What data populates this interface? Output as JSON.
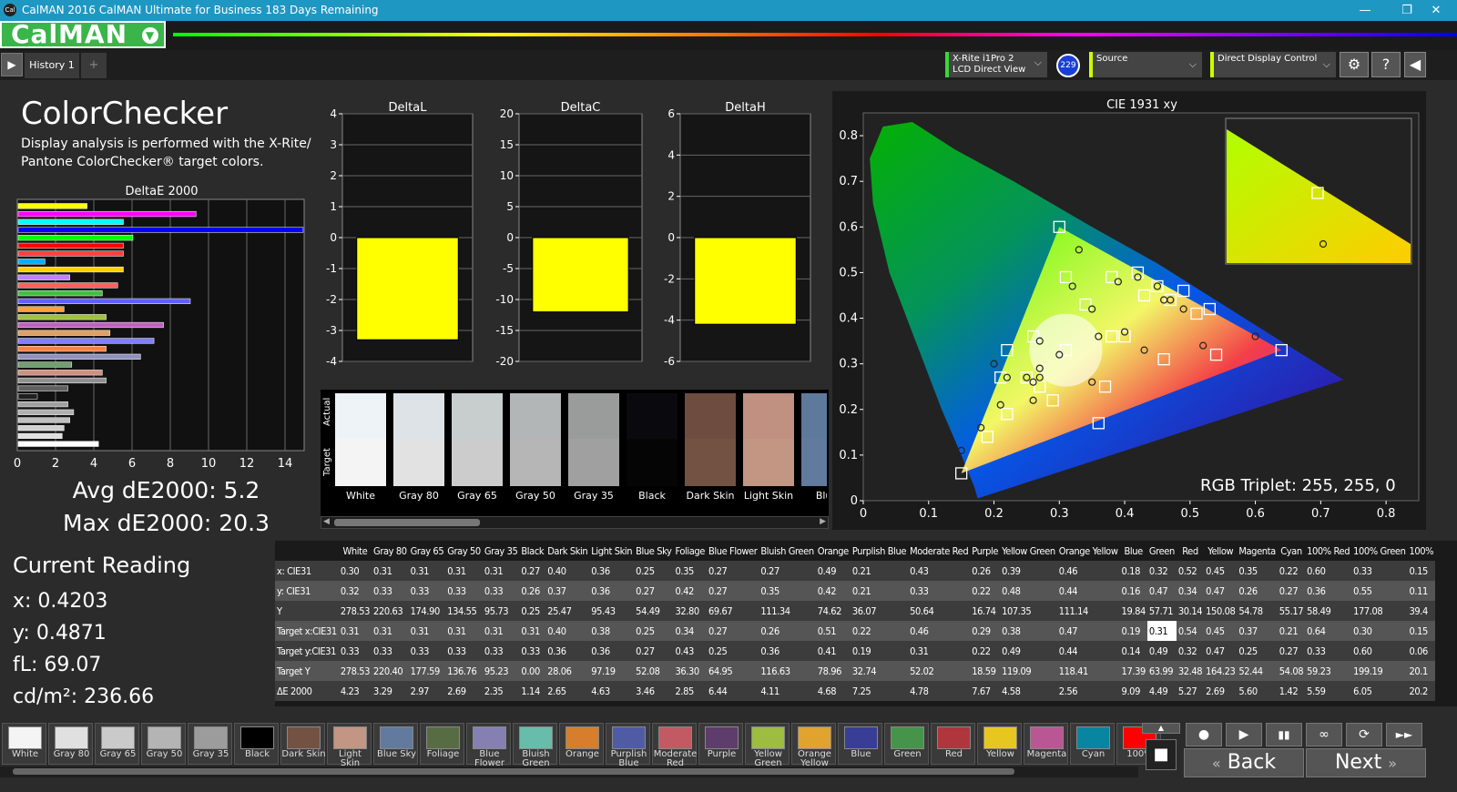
{
  "titlebar": {
    "title": "CalMAN 2016 CalMAN Ultimate for Business 183 Days Remaining",
    "icon": "Cal"
  },
  "logo": {
    "text": "CalMAN"
  },
  "tabs": {
    "history": "History 1",
    "add": "+"
  },
  "devices": {
    "meter_line1": "X-Rite i1Pro 2",
    "meter_line2": "LCD Direct View",
    "badge": "229",
    "source": "Source",
    "display": "Direct Display Control"
  },
  "left": {
    "title": "ColorChecker",
    "desc1": "Display analysis is performed with the X-Rite/",
    "desc2": "Pantone ColorChecker® target colors.",
    "de_title": "DeltaE 2000",
    "avg": "Avg dE2000: 5.2",
    "max": "Max dE2000: 20.3",
    "reading_title": "Current Reading",
    "x": "x: 0.4203",
    "y": "y: 0.4871",
    "fl": "fL: 69.07",
    "cdm": "cd/m²: 236.66"
  },
  "de_bars": {
    "values": [
      3.6,
      9.3,
      5.5,
      14.9,
      6.0,
      5.5,
      5.5,
      1.4,
      5.5,
      2.7,
      5.2,
      4.4,
      9.0,
      2.4,
      4.6,
      7.6,
      4.8,
      7.1,
      4.6,
      6.4,
      2.8,
      4.4,
      4.6,
      2.6,
      1.0,
      2.6,
      2.9,
      2.7,
      2.4,
      2.3,
      4.2
    ],
    "colors": [
      "#ffff00",
      "#ff00ff",
      "#00ffff",
      "#0000ff",
      "#00ff00",
      "#ff0000",
      "#ff4040",
      "#00b0ff",
      "#ffd000",
      "#c080ff",
      "#ff6060",
      "#40c040",
      "#6060ff",
      "#ffa040",
      "#a0c040",
      "#c060c0",
      "#e0a060",
      "#8080ff",
      "#ff8040",
      "#9090c0",
      "#70a070",
      "#d09080",
      "#909090",
      "#606060",
      "#202020",
      "#a0a0a0",
      "#b0b0b0",
      "#c0c0c0",
      "#d0d0d0",
      "#e0e0e0",
      "#ffffff"
    ],
    "ticks": [
      "0",
      "2",
      "4",
      "6",
      "8",
      "10",
      "12",
      "14"
    ]
  },
  "delta_charts": [
    {
      "title": "DeltaL",
      "ticks": [
        "4",
        "3",
        "2",
        "1",
        "0",
        "-1",
        "-2",
        "-3",
        "-4"
      ],
      "min": -4,
      "max": 4,
      "value": -3.3
    },
    {
      "title": "DeltaC",
      "ticks": [
        "20",
        "15",
        "10",
        "5",
        "0",
        "-5",
        "-10",
        "-15",
        "-20"
      ],
      "min": -20,
      "max": 20,
      "value": -12.0
    },
    {
      "title": "DeltaH",
      "ticks": [
        "6",
        "4",
        "2",
        "0",
        "-2",
        "-4",
        "-6"
      ],
      "min": -6,
      "max": 6,
      "value": -4.2
    }
  ],
  "patches": {
    "actual_label": "Actual",
    "target_label": "Target",
    "items": [
      {
        "name": "White",
        "actual": "#eef3f8",
        "target": "#f4f4f4"
      },
      {
        "name": "Gray 80",
        "actual": "#dde3e6",
        "target": "#e2e2e2"
      },
      {
        "name": "Gray 65",
        "actual": "#c8cdcd",
        "target": "#cccccc"
      },
      {
        "name": "Gray 50",
        "actual": "#b3b6b6",
        "target": "#b6b6b6"
      },
      {
        "name": "Gray 35",
        "actual": "#9a9c9c",
        "target": "#a0a0a0"
      },
      {
        "name": "Black",
        "actual": "#0a0a0e",
        "target": "#050505"
      },
      {
        "name": "Dark Skin",
        "actual": "#6e4c40",
        "target": "#735244"
      },
      {
        "name": "Light Skin",
        "actual": "#c09080",
        "target": "#c29682"
      },
      {
        "name": "Blue",
        "actual": "#5d7a9c",
        "target": "#627a9d"
      }
    ]
  },
  "cie": {
    "title": "CIE 1931 xy",
    "triplet": "RGB Triplet: 255, 255, 0",
    "xticks": [
      "0",
      "0.1",
      "0.2",
      "0.3",
      "0.4",
      "0.5",
      "0.6",
      "0.7",
      "0.8"
    ],
    "yticks": [
      "0.8",
      "0.7",
      "0.6",
      "0.5",
      "0.4",
      "0.3",
      "0.2",
      "0.1",
      "0"
    ]
  },
  "table": {
    "headers": [
      "",
      "White",
      "Gray 80",
      "Gray 65",
      "Gray 50",
      "Gray 35",
      "Black",
      "Dark Skin",
      "Light Skin",
      "Blue Sky",
      "Foliage",
      "Blue Flower",
      "Bluish Green",
      "Orange",
      "Purplish Blue",
      "Moderate Red",
      "Purple",
      "Yellow Green",
      "Orange Yellow",
      "Blue",
      "Green",
      "Red",
      "Yellow",
      "Magenta",
      "Cyan",
      "100% Red",
      "100% Green",
      "100%"
    ],
    "rows": [
      [
        "x: CIE31",
        "0.30",
        "0.31",
        "0.31",
        "0.31",
        "0.31",
        "0.27",
        "0.40",
        "0.36",
        "0.25",
        "0.35",
        "0.27",
        "0.27",
        "0.49",
        "0.21",
        "0.43",
        "0.26",
        "0.39",
        "0.46",
        "0.18",
        "0.32",
        "0.52",
        "0.45",
        "0.35",
        "0.22",
        "0.60",
        "0.33",
        "0.15"
      ],
      [
        "y: CIE31",
        "0.32",
        "0.33",
        "0.33",
        "0.33",
        "0.33",
        "0.26",
        "0.37",
        "0.36",
        "0.27",
        "0.42",
        "0.27",
        "0.35",
        "0.42",
        "0.21",
        "0.33",
        "0.22",
        "0.48",
        "0.44",
        "0.16",
        "0.47",
        "0.34",
        "0.47",
        "0.26",
        "0.27",
        "0.36",
        "0.55",
        "0.11"
      ],
      [
        "Y",
        "278.53",
        "220.63",
        "174.90",
        "134.55",
        "95.73",
        "0.25",
        "25.47",
        "95.43",
        "54.49",
        "32.80",
        "69.67",
        "111.34",
        "74.62",
        "36.07",
        "50.64",
        "16.74",
        "107.35",
        "111.14",
        "19.84",
        "57.71",
        "30.14",
        "150.08",
        "54.78",
        "55.17",
        "58.49",
        "177.08",
        "39.4"
      ],
      [
        "Target x:CIE31",
        "0.31",
        "0.31",
        "0.31",
        "0.31",
        "0.31",
        "0.31",
        "0.40",
        "0.38",
        "0.25",
        "0.34",
        "0.27",
        "0.26",
        "0.51",
        "0.22",
        "0.46",
        "0.29",
        "0.38",
        "0.47",
        "0.19",
        "0.31",
        "0.54",
        "0.45",
        "0.37",
        "0.21",
        "0.64",
        "0.30",
        "0.15"
      ],
      [
        "Target y:CIE31",
        "0.33",
        "0.33",
        "0.33",
        "0.33",
        "0.33",
        "0.33",
        "0.36",
        "0.36",
        "0.27",
        "0.43",
        "0.25",
        "0.36",
        "0.41",
        "0.19",
        "0.31",
        "0.22",
        "0.49",
        "0.44",
        "0.14",
        "0.49",
        "0.32",
        "0.47",
        "0.25",
        "0.27",
        "0.33",
        "0.60",
        "0.06"
      ],
      [
        "Target Y",
        "278.53",
        "220.40",
        "177.59",
        "136.76",
        "95.23",
        "0.00",
        "28.06",
        "97.19",
        "52.08",
        "36.30",
        "64.95",
        "116.63",
        "78.96",
        "32.74",
        "52.02",
        "18.59",
        "119.09",
        "118.41",
        "17.39",
        "63.99",
        "32.48",
        "164.23",
        "52.44",
        "54.08",
        "59.23",
        "199.19",
        "20.1"
      ],
      [
        "ΔE 2000",
        "4.23",
        "3.29",
        "2.97",
        "2.69",
        "2.35",
        "1.14",
        "2.65",
        "4.63",
        "3.46",
        "2.85",
        "6.44",
        "4.11",
        "4.68",
        "7.25",
        "4.78",
        "7.67",
        "4.58",
        "2.56",
        "9.09",
        "4.49",
        "5.27",
        "2.69",
        "5.60",
        "1.42",
        "5.59",
        "6.05",
        "20.2"
      ]
    ]
  },
  "swatches": [
    {
      "label": "White",
      "color": "#f4f4f4"
    },
    {
      "label": "Gray 80",
      "color": "#e0e0e0"
    },
    {
      "label": "Gray 65",
      "color": "#cacaca"
    },
    {
      "label": "Gray 50",
      "color": "#b4b4b4"
    },
    {
      "label": "Gray 35",
      "color": "#9c9c9c"
    },
    {
      "label": "Black",
      "color": "#000000"
    },
    {
      "label": "Dark Skin",
      "color": "#735244"
    },
    {
      "label": "Light Skin",
      "color": "#c29682"
    },
    {
      "label": "Blue Sky",
      "color": "#627a9d"
    },
    {
      "label": "Foliage",
      "color": "#576c43"
    },
    {
      "label": "Blue Flower",
      "color": "#8580b1"
    },
    {
      "label": "Bluish Green",
      "color": "#67bdaa"
    },
    {
      "label": "Orange",
      "color": "#d67e2c"
    },
    {
      "label": "Purplish Blue",
      "color": "#505ba6"
    },
    {
      "label": "Moderate Red",
      "color": "#c15a63"
    },
    {
      "label": "Purple",
      "color": "#5e3c6c"
    },
    {
      "label": "Yellow Green",
      "color": "#9dbc40"
    },
    {
      "label": "Orange Yellow",
      "color": "#e0a32e"
    },
    {
      "label": "Blue",
      "color": "#383d96"
    },
    {
      "label": "Green",
      "color": "#469449"
    },
    {
      "label": "Red",
      "color": "#af363c"
    },
    {
      "label": "Yellow",
      "color": "#e7c71f"
    },
    {
      "label": "Magenta",
      "color": "#bb5695"
    },
    {
      "label": "Cyan",
      "color": "#0885a1"
    },
    {
      "label": "100%",
      "color": "#ff0000"
    }
  ],
  "nav": {
    "back": "Back",
    "next": "Next"
  }
}
